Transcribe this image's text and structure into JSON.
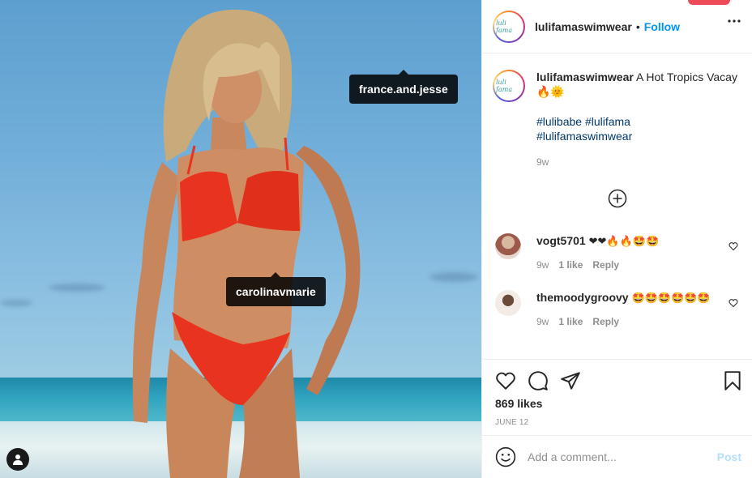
{
  "post": {
    "username": "lulifamaswimwear",
    "follow_label": "Follow",
    "separator": "•",
    "avatar_text": "luli fama",
    "more_icon": "more-horizontal-icon"
  },
  "photo": {
    "tags": [
      {
        "label": "france.and.jesse"
      },
      {
        "label": "carolinavmarie"
      }
    ]
  },
  "caption": {
    "username": "lulifamaswimwear",
    "text": "A Hot Tropics Vacay 🔥🌞",
    "hashtags": [
      "#lulibabe #lulifama",
      "#lulifamaswimwear"
    ],
    "time": "9w"
  },
  "comments": [
    {
      "username": "vogt5701",
      "text": "❤❤🔥🔥🤩🤩",
      "time": "9w",
      "likes": "1 like",
      "reply": "Reply"
    },
    {
      "username": "themoodygroovy",
      "text": "🤩🤩🤩🤩🤩🤩",
      "time": "9w",
      "likes": "1 like",
      "reply": "Reply"
    }
  ],
  "stats": {
    "likes": "869 likes",
    "date": "JUNE 12"
  },
  "composer": {
    "placeholder": "Add a comment...",
    "post_label": "Post"
  },
  "colors": {
    "accent": "#0095f6",
    "text": "#262626",
    "muted": "#8e8e8e",
    "hashtag": "#00376b",
    "post_disabled": "#b2dffc"
  }
}
